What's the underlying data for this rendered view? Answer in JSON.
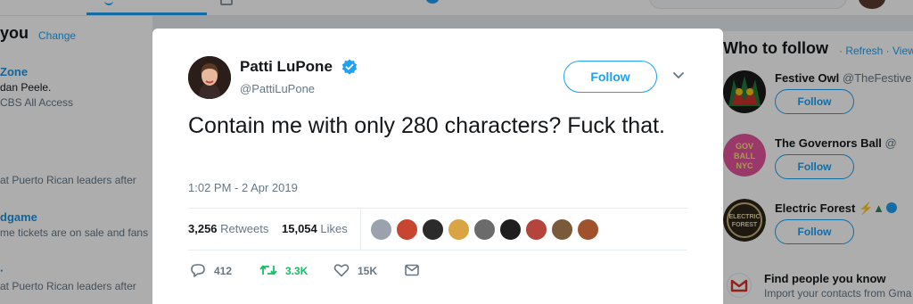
{
  "background": {
    "trends": {
      "header": "you",
      "change_link": "Change",
      "items": [
        {
          "title": "Zone",
          "line": "dan Peele.",
          "sub": "CBS All Access"
        },
        {
          "title": "",
          "line": "",
          "sub": "at Puerto Rican leaders after"
        },
        {
          "title": "dgame",
          "line": "",
          "sub": "me tickets are on sale and fans"
        },
        {
          "title": "",
          "line": "",
          "sub": "at Puerto Rican leaders after"
        }
      ]
    },
    "who_to_follow": {
      "header": "Who to follow",
      "links": "· Refresh · View a",
      "accounts": [
        {
          "name": "Festive Owl",
          "handle": "@TheFestive",
          "follow_label": "Follow"
        },
        {
          "name": "The Governors Ball",
          "handle": "@",
          "follow_label": "Follow"
        },
        {
          "name": "Electric Forest",
          "handle": "",
          "follow_label": "Follow"
        }
      ],
      "find_people_title": "Find people you know",
      "find_people_sub": "Import your contacts from Gma"
    }
  },
  "tweet": {
    "author_name": "Patti LuPone",
    "author_handle": "@PattiLuPone",
    "verified": true,
    "follow_label": "Follow",
    "text": "Contain me with only 280 characters? Fuck that.",
    "timestamp": "1:02 PM - 2 Apr 2019",
    "retweets_count": "3,256",
    "retweets_label": "Retweets",
    "likes_count": "15,054",
    "likes_label": "Likes",
    "likers_count": 9,
    "actions": {
      "reply_count": "412",
      "retweet_count": "3.3K",
      "like_count": "15K"
    }
  },
  "colors": {
    "accent": "#1da1f2",
    "retweet_green": "#17bf63",
    "text_primary": "#14171a",
    "text_secondary": "#657786"
  }
}
